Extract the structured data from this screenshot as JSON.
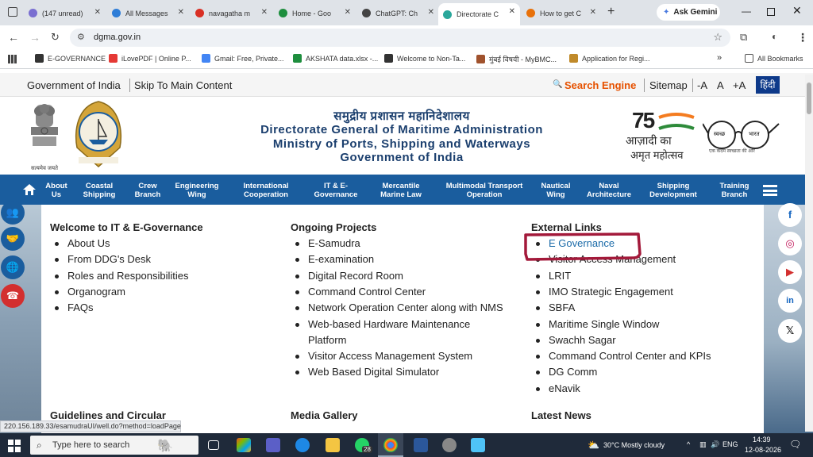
{
  "tabs": [
    {
      "title": "(147 unread)",
      "color": "#7a6fd1"
    },
    {
      "title": "All Messages",
      "color": "#2e7dd7"
    },
    {
      "title": "navagatha m",
      "color": "#d93025"
    },
    {
      "title": "Home - Goo",
      "color": "#1e8e3e"
    },
    {
      "title": "ChatGPT: Ch",
      "color": "#444444"
    },
    {
      "title": "Directorate C",
      "color": "#2aa79b"
    },
    {
      "title": "How to get C",
      "color": "#e8710a"
    }
  ],
  "gemini_label": "Ask Gemini",
  "address_url": "dgma.gov.in",
  "bookmarks": [
    {
      "label": "E-GOVERNANCE",
      "color": "#333333"
    },
    {
      "label": "iLovePDF | Online P...",
      "color": "#e53935"
    },
    {
      "label": "Gmail: Free, Private...",
      "color": "#4285f4"
    },
    {
      "label": "AKSHATA data.xlsx -...",
      "color": "#1e8e3e"
    },
    {
      "label": "Welcome to Non-Ta...",
      "color": "#333333"
    },
    {
      "label": "मुंबई विषयी - MyBMC...",
      "color": "#a0522d"
    },
    {
      "label": "Application for Regi...",
      "color": "#c08a2a"
    }
  ],
  "all_bookmarks": "All Bookmarks",
  "gov_strip": {
    "gov_india": "Government of India",
    "skip": "Skip To Main Content",
    "search": "Search Engine",
    "sitemap": "Sitemap",
    "font_minus": "-A",
    "font_normal": "A",
    "font_plus": "+A",
    "hindi": "हिंदी"
  },
  "header": {
    "hindi_title": "समुद्रीय प्रशासन महानिदेशालय",
    "line1": "Directorate General of Maritime Administration",
    "line2": "Ministry of Ports, Shipping and Waterways",
    "line3": "Government of India",
    "emblem_caption": "सत्यमेव जयते",
    "azadi_75": "75",
    "azadi_l1": "आज़ादी का",
    "azadi_l2": "अमृत महोत्सव",
    "swachh_l1": "स्वच्छ",
    "swachh_l2": "भारत",
    "swachh_tag": "एक कदम स्वच्छता की ओर"
  },
  "nav": [
    {
      "l1": "About",
      "l2": "Us"
    },
    {
      "l1": "Coastal",
      "l2": "Shipping"
    },
    {
      "l1": "Crew",
      "l2": "Branch"
    },
    {
      "l1": "Engineering",
      "l2": "Wing"
    },
    {
      "l1": "International",
      "l2": "Cooperation"
    },
    {
      "l1": "IT & E-",
      "l2": "Governance"
    },
    {
      "l1": "Mercantile",
      "l2": "Marine Law"
    },
    {
      "l1": "Multimodal Transport",
      "l2": "Operation"
    },
    {
      "l1": "Nautical",
      "l2": "Wing"
    },
    {
      "l1": "Naval",
      "l2": "Architecture"
    },
    {
      "l1": "Shipping",
      "l2": "Development"
    },
    {
      "l1": "Training",
      "l2": "Branch"
    }
  ],
  "col1": {
    "heading": "Welcome to IT & E-Governance",
    "items": [
      "About Us",
      "From DDG's Desk",
      "Roles and Responsibilities",
      "Organogram",
      "FAQs"
    ],
    "next_heading": "Guidelines and Circular"
  },
  "col2": {
    "heading": "Ongoing Projects",
    "items": [
      "E-Samudra",
      "E-examination",
      "Digital Record Room",
      "Command Control Center",
      "Network Operation Center along with NMS",
      "Web-based Hardware Maintenance",
      "Platform",
      "Visitor Access Management System",
      "Web Based Digital Simulator"
    ],
    "next_heading": "Media Gallery"
  },
  "col3": {
    "heading": "External Links",
    "items": [
      "E Governance",
      "Visitor Access Management",
      "LRIT",
      "IMO Strategic Engagement",
      "SBFA",
      "Maritime Single Window",
      "Swachh Sagar",
      "Command Control Center and KPIs",
      "DG Comm",
      "eNavik"
    ],
    "next_heading": "Latest News"
  },
  "highlight_color": "#a3193a",
  "status_url": "220.156.189.33/esamudraUI/well.do?method=loadPage",
  "taskbar": {
    "search_placeholder": "Type here to search",
    "whatsapp_badge": "28",
    "weather": "30°C  Mostly cloudy",
    "lang": "ENG",
    "time": "14:39",
    "date": "12-08-2026"
  }
}
